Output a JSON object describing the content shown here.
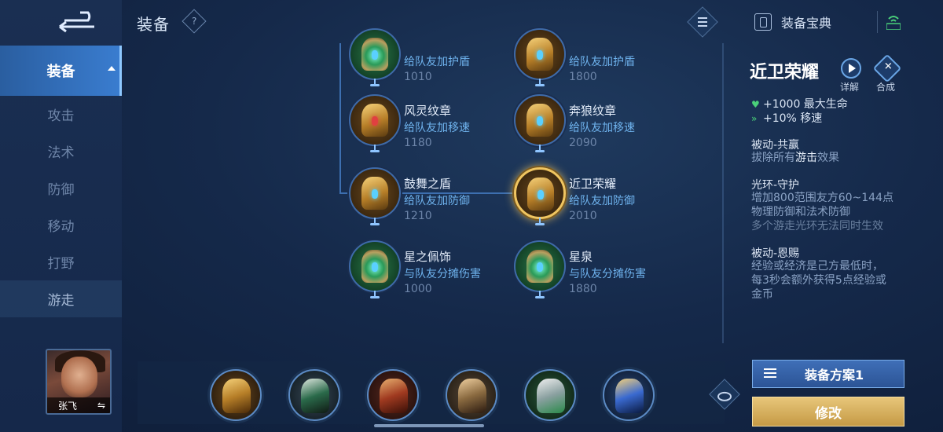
{
  "header": {
    "title": "装备",
    "help_icon": "question-icon",
    "codex_label": "装备宝典"
  },
  "sidebar": {
    "items": [
      {
        "label": "装备",
        "state": "expanded"
      },
      {
        "label": "攻击"
      },
      {
        "label": "法术"
      },
      {
        "label": "防御"
      },
      {
        "label": "移动"
      },
      {
        "label": "打野"
      },
      {
        "label": "游走",
        "state": "selected"
      }
    ],
    "hero": {
      "name": "张飞",
      "swap_icon": "⇋"
    }
  },
  "tree": {
    "items": [
      {
        "name": "",
        "desc": "给队友加护盾",
        "price": "1010",
        "style": "green"
      },
      {
        "name": "",
        "desc": "给队友加护盾",
        "price": "1800",
        "style": "gold"
      },
      {
        "name": "风灵纹章",
        "desc": "给队友加移速",
        "price": "1180",
        "style": "gold"
      },
      {
        "name": "奔狼纹章",
        "desc": "给队友加移速",
        "price": "2090",
        "style": "gold"
      },
      {
        "name": "鼓舞之盾",
        "desc": "给队友加防御",
        "price": "1210",
        "style": "gold"
      },
      {
        "name": "近卫荣耀",
        "desc": "给队友加防御",
        "price": "2010",
        "style": "gold",
        "selected": true
      },
      {
        "name": "星之佩饰",
        "desc": "与队友分摊伤害",
        "price": "1000",
        "style": "green"
      },
      {
        "name": "星泉",
        "desc": "与队友分摊伤害",
        "price": "1880",
        "style": "green"
      }
    ]
  },
  "detail": {
    "title": "近卫荣耀",
    "detail_btn": "详解",
    "combine_btn": "合成",
    "stats": [
      "+1000 最大生命",
      "+10% 移速"
    ],
    "passive1_title": "被动-共赢",
    "passive1_pre": "拔除所有",
    "passive1_hl": "游击",
    "passive1_post": "效果",
    "aura_title": "光环-守护",
    "aura_line1": "增加800范围友方60~144点",
    "aura_line2": "物理防御和法术防御",
    "aura_note": "多个游走光环无法同时生效",
    "passive2_title": "被动-恩赐",
    "passive2_line1": "经验或经济是己方最低时，",
    "passive2_line2": "每3秒会额外获得5点经验或",
    "passive2_line3": "金币"
  },
  "loadout": {
    "slots": [
      "gold",
      "boots",
      "red-gold",
      "gold",
      "silver-green",
      "blue-gold"
    ]
  },
  "buttons": {
    "scheme": "装备方案1",
    "edit": "修改"
  },
  "colors": {
    "accent_blue": "#3a7dd0",
    "price_text": "#6c84a8",
    "desc_text": "#6fb3ee",
    "edit_gold": "#c59a45"
  }
}
